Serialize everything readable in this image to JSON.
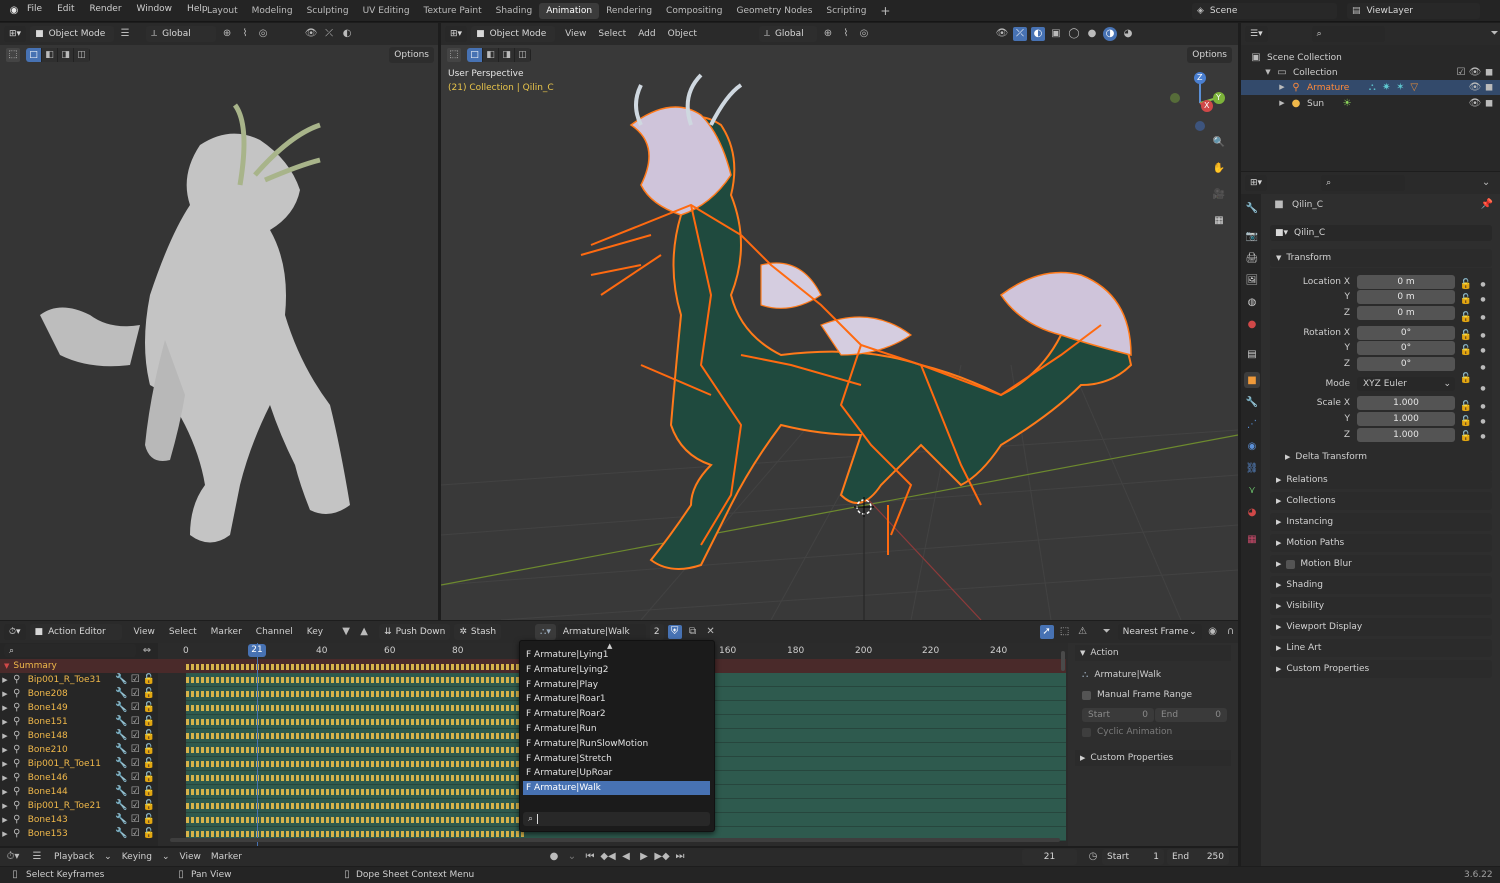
{
  "topbar": {
    "menus": [
      "File",
      "Edit",
      "Render",
      "Window",
      "Help"
    ],
    "workspaces": [
      "Layout",
      "Modeling",
      "Sculpting",
      "UV Editing",
      "Texture Paint",
      "Shading",
      "Animation",
      "Rendering",
      "Compositing",
      "Geometry Nodes",
      "Scripting"
    ],
    "active_workspace": "Animation",
    "scene": "Scene",
    "view_layer": "ViewLayer"
  },
  "left_viewport": {
    "mode": "Object Mode",
    "orientation": "Global",
    "options": "Options"
  },
  "main_viewport": {
    "mode": "Object Mode",
    "menus": [
      "View",
      "Select",
      "Add",
      "Object"
    ],
    "orientation": "Global",
    "options": "Options",
    "overlay_title": "User Perspective",
    "overlay_subtitle": "(21) Collection | Qilin_C",
    "gizmo": {
      "z": "Z",
      "y": "Y",
      "x": "X"
    }
  },
  "outliner": {
    "rows": [
      {
        "label": "Scene Collection"
      },
      {
        "label": "Collection"
      },
      {
        "label": "Armature"
      },
      {
        "label": "Sun"
      }
    ]
  },
  "properties": {
    "object_name": "Qilin_C",
    "object_field": "Qilin_C",
    "transform_title": "Transform",
    "location": {
      "label": "Location X",
      "x": "0 m",
      "y": "0 m",
      "z": "0 m"
    },
    "rotation": {
      "label": "Rotation X",
      "x": "0°",
      "y": "0°",
      "z": "0°"
    },
    "mode_label": "Mode",
    "mode_value": "XYZ Euler",
    "scale": {
      "label": "Scale X",
      "x": "1.000",
      "y": "1.000",
      "z": "1.000"
    },
    "axis": {
      "y": "Y",
      "z": "Z"
    },
    "delta": "Delta Transform",
    "panels": [
      "Relations",
      "Collections",
      "Instancing",
      "Motion Paths",
      "Motion Blur",
      "Shading",
      "Visibility",
      "Viewport Display",
      "Line Art",
      "Custom Properties"
    ]
  },
  "dopesheet": {
    "editor_type": "Action Editor",
    "menus": [
      "View",
      "Select",
      "Marker",
      "Channel",
      "Key"
    ],
    "push_down": "Push Down",
    "stash": "Stash",
    "action": "Armature|Walk",
    "users": "2",
    "snap": "Nearest Frame",
    "current_frame": "21",
    "ruler_left": [
      "0",
      "40",
      "60",
      "80"
    ],
    "ruler_right": [
      "160",
      "180",
      "200",
      "220",
      "240"
    ],
    "summary": "Summary",
    "channels": [
      "Bip001_R_Toe31",
      "Bone208",
      "Bone149",
      "Bone151",
      "Bone148",
      "Bone210",
      "Bip001_R_Toe11",
      "Bone146",
      "Bone144",
      "Bip001_R_Toe21",
      "Bone143",
      "Bone153"
    ],
    "dropdown_items": [
      "F Armature|Lying1",
      "F Armature|Lying2",
      "F Armature|Play",
      "F Armature|Roar1",
      "F Armature|Roar2",
      "F Armature|Run",
      "F Armature|RunSlowMotion",
      "F Armature|Stretch",
      "F Armature|UpRoar",
      "F Armature|Walk"
    ],
    "dropdown_selected": "F Armature|Walk",
    "sidebar": {
      "action_title": "Action",
      "action_name": "Armature|Walk",
      "manual_range": "Manual Frame Range",
      "start_label": "Start",
      "start_val": "0",
      "end_label": "End",
      "end_val": "0",
      "cyclic": "Cyclic Animation",
      "custom": "Custom Properties"
    }
  },
  "timeline": {
    "menus": [
      "Playback",
      "Keying",
      "View",
      "Marker"
    ],
    "frame": "21",
    "start_label": "Start",
    "start": "1",
    "end_label": "End",
    "end": "250"
  },
  "status": {
    "left": "Select Keyframes",
    "mid": "Pan View",
    "right": "Dope Sheet Context Menu",
    "version": "3.6.22"
  },
  "colors": {
    "accent": "#4772b3",
    "selection_orange": "#ff7a1a",
    "channel_text": "#f0b84a",
    "key_fill": "#2e5a4e"
  }
}
